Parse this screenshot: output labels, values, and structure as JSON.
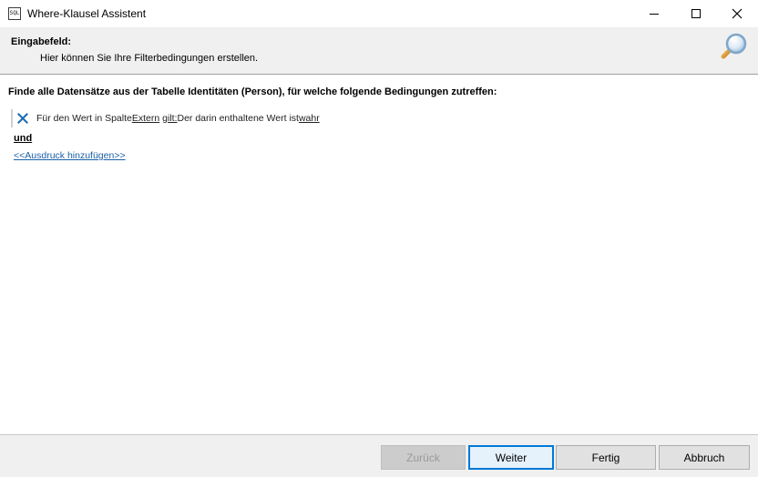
{
  "window": {
    "title": "Where-Klausel Assistent",
    "icon_name": "where-clause-app-icon",
    "icon_text": "SQL"
  },
  "header": {
    "title": "Eingabefeld:",
    "description": "Hier können Sie Ihre Filterbedingungen erstellen.",
    "icon_name": "magnifier-icon"
  },
  "main": {
    "headline": "Finde alle Datensätze aus der Tabelle Identitäten (Person), für welche folgende Bedingungen zutreffen:",
    "condition": {
      "delete_icon": "delete-x-icon",
      "prefix": "Für den Wert in Spalte ",
      "column": "Extern",
      "verb": "gilt:",
      "mid": " Der darin enthaltene Wert ist ",
      "value": "wahr"
    },
    "conjunction": "und",
    "add_expression": "<<Ausdruck hinzufügen>>"
  },
  "footer": {
    "back": "Zurück",
    "next": "Weiter",
    "finish": "Fertig",
    "cancel": "Abbruch"
  },
  "colors": {
    "accent": "#0078d7",
    "link": "#1a5fa8",
    "delete_icon": "#1f6fb2"
  }
}
